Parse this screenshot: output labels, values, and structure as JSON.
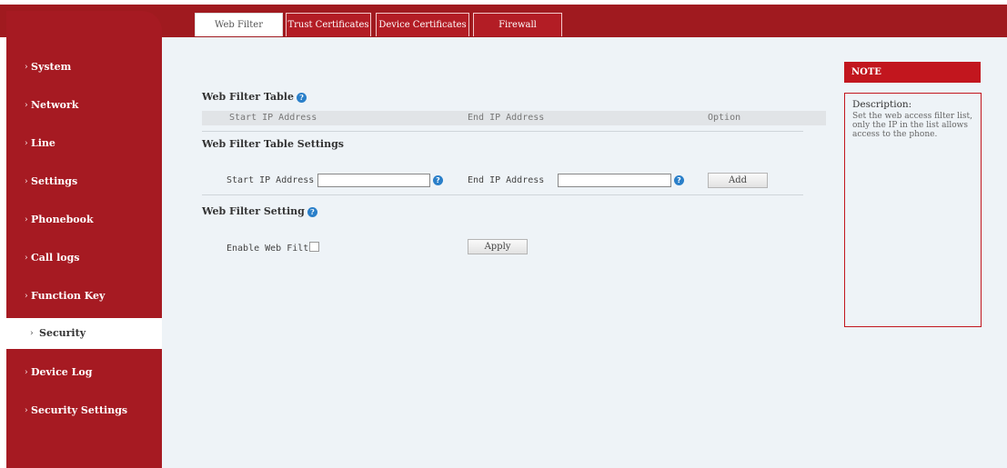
{
  "tabs": [
    {
      "label": "Web Filter",
      "active": true
    },
    {
      "label": "Trust Certificates",
      "active": false
    },
    {
      "label": "Device Certificates",
      "active": false
    },
    {
      "label": "Firewall",
      "active": false
    }
  ],
  "sidebar": {
    "items": [
      {
        "label": "System"
      },
      {
        "label": "Network"
      },
      {
        "label": "Line"
      },
      {
        "label": "Settings"
      },
      {
        "label": "Phonebook"
      },
      {
        "label": "Call logs"
      },
      {
        "label": "Function Key"
      },
      {
        "label": "Security",
        "active": true
      },
      {
        "label": "Device Log"
      },
      {
        "label": "Security Settings"
      }
    ],
    "arrow": "›"
  },
  "main": {
    "table_title": "Web Filter Table",
    "table_columns": [
      "Start IP Address",
      "End IP Address",
      "Option"
    ],
    "settings_title": "Web Filter Table Settings",
    "start_ip_label": "Start IP Address",
    "start_ip_value": "",
    "end_ip_label": "End IP Address",
    "end_ip_value": "",
    "add_label": "Add",
    "filter_setting_title": "Web Filter Setting",
    "enable_label": "Enable Web Filter",
    "enable_checked": false,
    "apply_label": "Apply"
  },
  "note": {
    "header": "NOTE",
    "title": "Description:",
    "text": "Set the web access filter list, only the IP in the list allows access to the phone."
  },
  "colors": {
    "brand_red": "#a61a22",
    "help_blue": "#2a7fc9",
    "background": "#eef3f7"
  },
  "icons": {
    "help": "question-circle-icon",
    "nav_arrow": "chevron-right-icon"
  }
}
